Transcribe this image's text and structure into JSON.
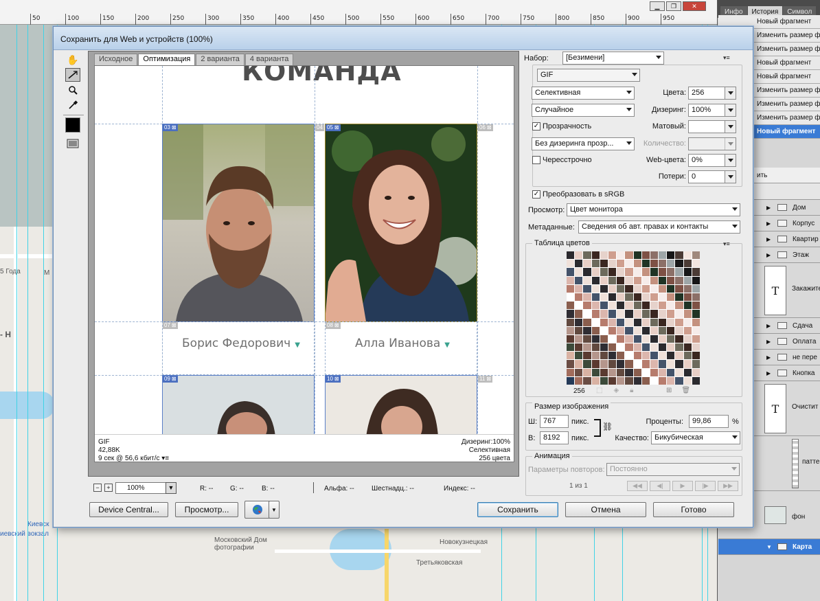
{
  "dialog": {
    "title": "Сохранить для Web и устройств (100%)",
    "tabs": [
      "Исходное",
      "Оптимизация",
      "2 варианта",
      "4 варианта"
    ],
    "active_tab": 1
  },
  "preview": {
    "heading": "КОМАНДА",
    "slices": [
      "03",
      "04",
      "05",
      "06",
      "07",
      "08",
      "09",
      "10",
      "11"
    ],
    "people": [
      {
        "name": "Борис Федорович"
      },
      {
        "name": "Алла Иванова"
      }
    ],
    "status": {
      "format": "GIF",
      "size": "42,88K",
      "time": "9 сек @ 56,6 кбит/с",
      "dither": "Дизеринг:100%",
      "palette": "Селективная",
      "colors": "256 цвета"
    }
  },
  "bottom_info": {
    "zoom": "100%",
    "r": "R: --",
    "g": "G: --",
    "b": "B: --",
    "alpha": "Альфа: --",
    "hex": "Шестнадц.: --",
    "index": "Индекс: --"
  },
  "buttons": {
    "device_central": "Device Central...",
    "preview": "Просмотр...",
    "save": "Сохранить",
    "cancel": "Отмена",
    "done": "Готово"
  },
  "settings": {
    "preset_label": "Набор:",
    "preset_value": "[Безимени]",
    "format": "GIF",
    "reduction": "Селективная",
    "dither_algo": "Случайное",
    "colors_label": "Цвета:",
    "colors_value": "256",
    "dither_label": "Дизеринг:",
    "dither_value": "100%",
    "transparency_label": "Прозрачность",
    "transparency_checked": true,
    "matte_label": "Матовый:",
    "matte_value": "",
    "transp_dither": "Без дизеринга прозр...",
    "amount_label": "Количество:",
    "interlaced_label": "Чересстрочно",
    "interlaced_checked": false,
    "websnap_label": "Web-цвета:",
    "websnap_value": "0%",
    "lossy_label": "Потери:",
    "lossy_value": "0",
    "srgb_label": "Преобразовать в sRGB",
    "srgb_checked": true,
    "view_label": "Просмотр:",
    "view_value": "Цвет монитора",
    "meta_label": "Метаданные:",
    "meta_value": "Сведения об авт. правах и контакты",
    "color_table_title": "Таблица цветов",
    "color_count": "256",
    "image_size_title": "Размер изображения",
    "width_label": "Ш:",
    "width_value": "767",
    "height_label": "В:",
    "height_value": "8192",
    "px": "пикс.",
    "percent_label": "Проценты:",
    "percent_value": "99,86",
    "percent_sign": "%",
    "quality_label": "Качество:",
    "quality_value": "Бикубическая",
    "animation_title": "Анимация",
    "loop_label": "Параметры повторов:",
    "loop_value": "Постоянно",
    "frame": "1 из 1"
  },
  "right_panel": {
    "tabs": [
      "Инфо",
      "История",
      "Символ"
    ],
    "history": [
      "Новый фрагмент",
      "Изменить размер ф",
      "Изменить размер ф",
      "Новый фрагмент",
      "Новый фрагмент",
      "Изменить размер ф",
      "Изменить размер ф",
      "Изменить размер ф",
      "Новый фрагмент"
    ],
    "layers_header": "ить",
    "layers": [
      "Дом",
      "Корпус",
      "Квартир",
      "Этаж",
      "Закажите",
      "Сдача",
      "Оплата",
      "не пере",
      "Кнопка",
      "Очистит",
      "паттe",
      "фон",
      "Карта"
    ]
  },
  "background": {
    "ruler_labels": [
      "50",
      "100",
      "150",
      "200",
      "250",
      "300",
      "350",
      "400",
      "450",
      "500",
      "550",
      "600",
      "650",
      "700",
      "750",
      "800",
      "850",
      "900",
      "950"
    ],
    "map_labels": [
      "5 Года",
      "М",
      "- Н",
      "Киевск",
      "иевский вокзал",
      "Московский Дом фотографии",
      "Новокузнецкая",
      "Третьяковская"
    ]
  }
}
